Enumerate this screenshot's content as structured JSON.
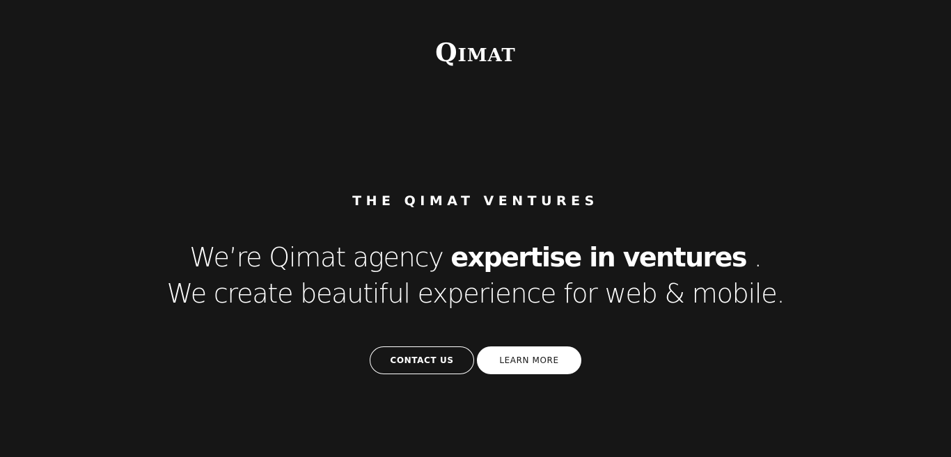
{
  "header": {
    "logo_initial": "Q",
    "logo_rest": "IMAT"
  },
  "hero": {
    "eyebrow": "THE QIMAT VENTURES",
    "headline_line1_regular": "We’re Qimat agency ",
    "headline_line1_bold": "expertise in ventures",
    "headline_line1_end": " .",
    "headline_line2": "We create beautiful experience for web & mobile."
  },
  "actions": {
    "contact_label": "CONTACT US",
    "learn_label": "LEARN MORE"
  },
  "colors": {
    "background": "#161616",
    "text": "#ffffff"
  }
}
